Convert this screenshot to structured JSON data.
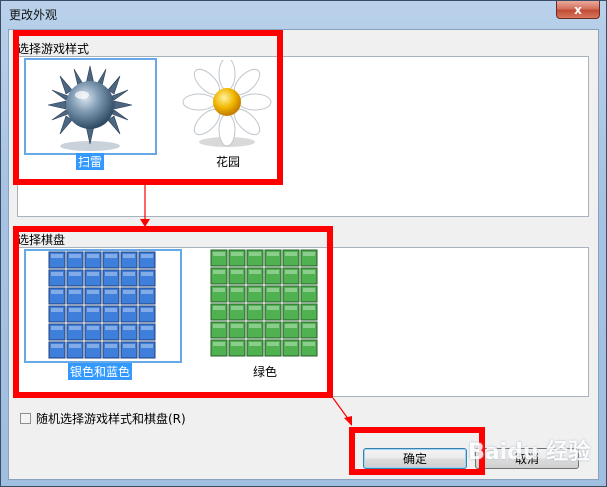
{
  "window": {
    "title": "更改外观",
    "close_glyph": "x"
  },
  "game_style": {
    "label": "选择游戏样式",
    "options": [
      {
        "label": "扫雷",
        "selected": true,
        "icon": "mine-icon"
      },
      {
        "label": "花园",
        "selected": false,
        "icon": "flower-icon"
      }
    ]
  },
  "board": {
    "label": "选择棋盘",
    "options": [
      {
        "label": "银色和蓝色",
        "selected": true,
        "icon": "blue-grid-icon",
        "color": "#3f7fdc"
      },
      {
        "label": "绿色",
        "selected": false,
        "icon": "green-grid-icon",
        "color": "#4fb14f"
      }
    ]
  },
  "random_checkbox": {
    "label": "随机选择游戏样式和棋盘(R)",
    "checked": false
  },
  "buttons": {
    "ok": "确定",
    "cancel": "取消"
  },
  "annotation_color": "#ff0000",
  "watermark": "Baidu 经验"
}
